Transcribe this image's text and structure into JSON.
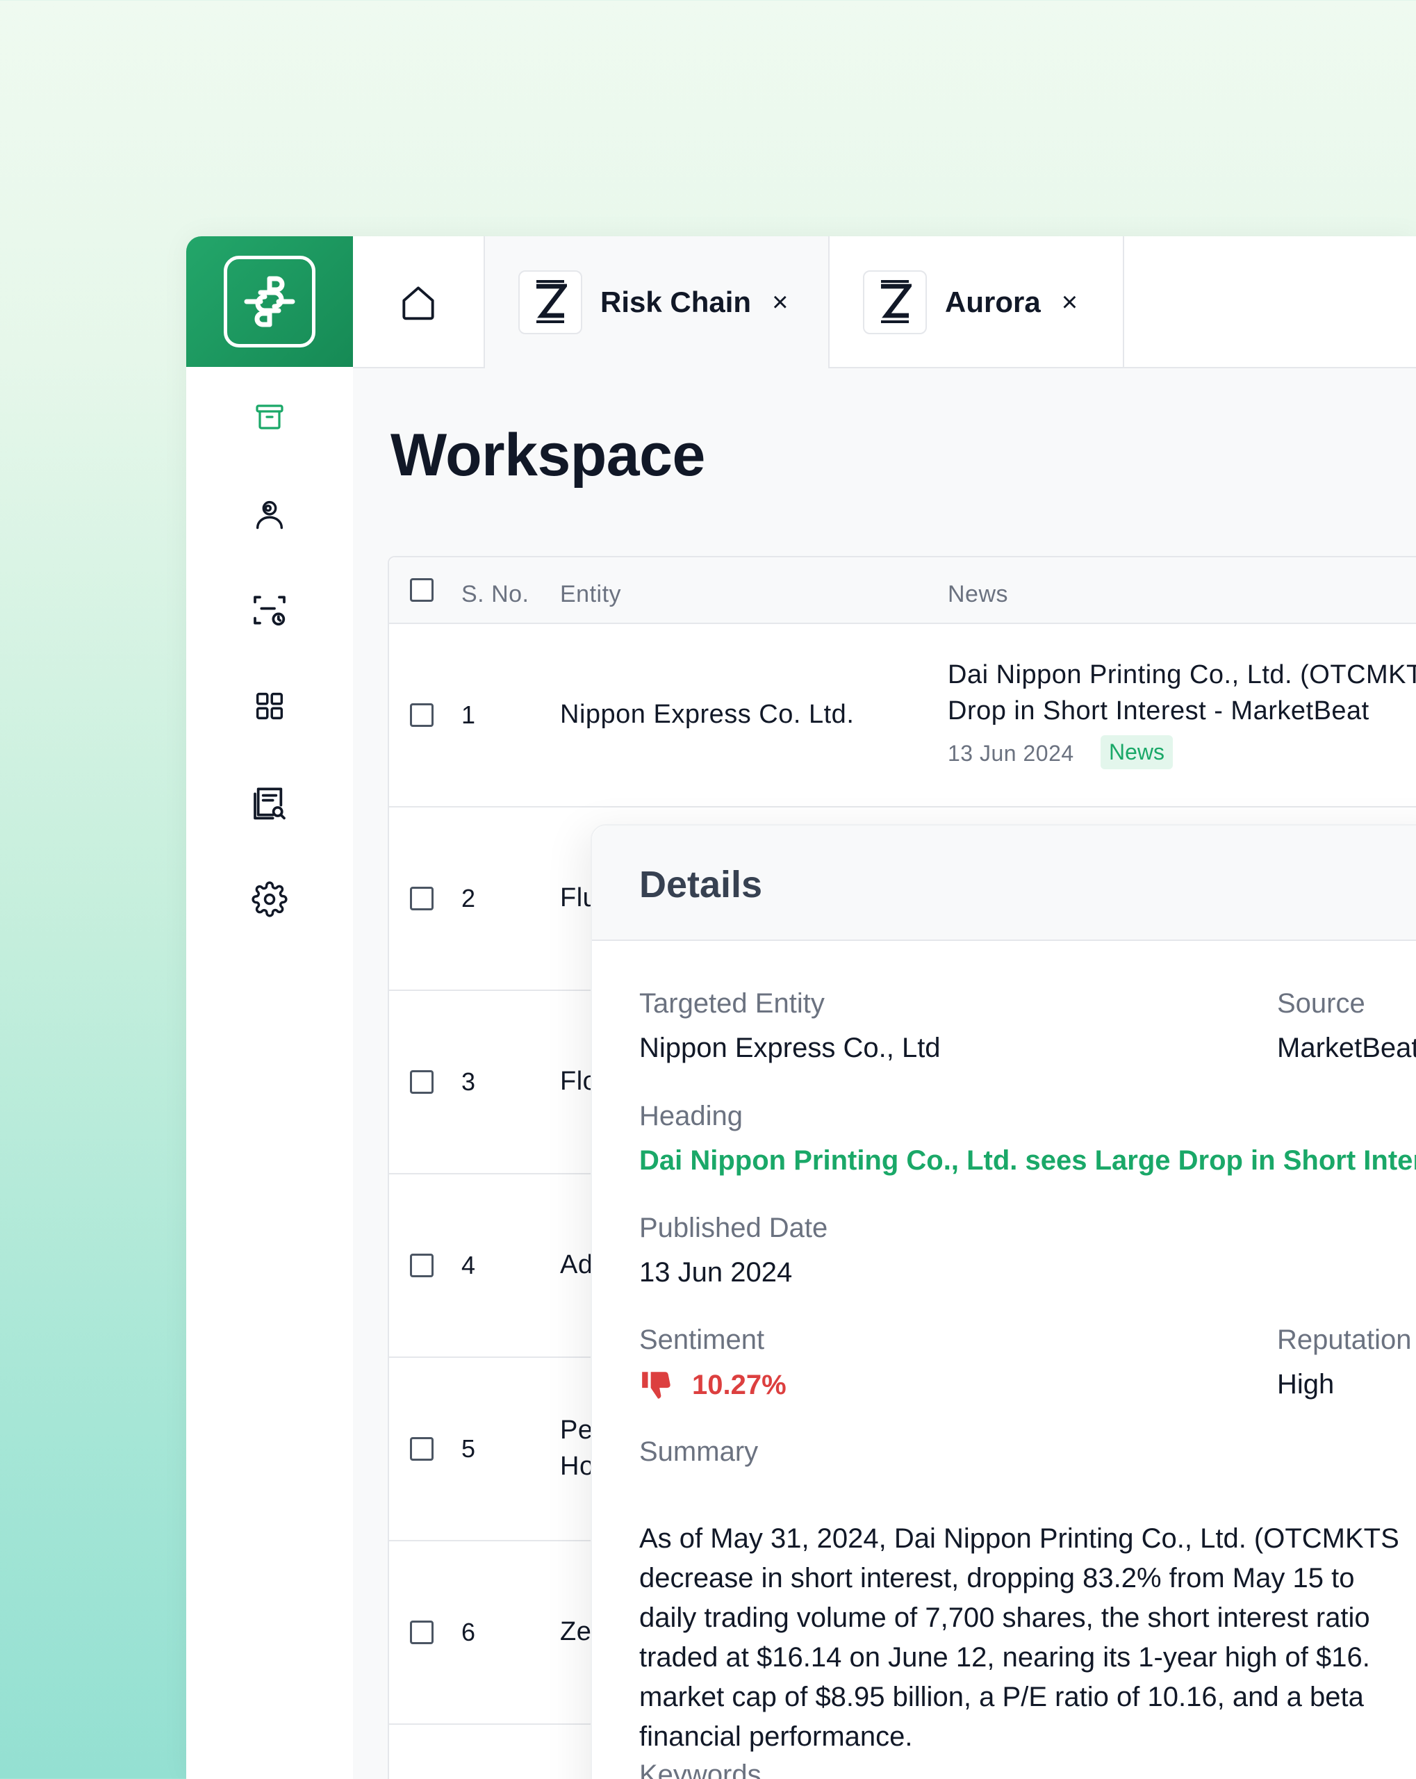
{
  "tabs": [
    {
      "label": "Risk Chain",
      "close": "×"
    },
    {
      "label": "Aurora",
      "close": "×"
    }
  ],
  "sidebar": {
    "items": [
      "archive-icon",
      "user-search-icon",
      "scan-clock-icon",
      "grid-icon",
      "document-search-icon",
      "gear-icon"
    ],
    "active_color": "#1aa868"
  },
  "page": {
    "title": "Workspace"
  },
  "table": {
    "headers": [
      "S. No.",
      "Entity",
      "News"
    ],
    "rows": [
      {
        "num": "1",
        "entity": "Nippon Express Co. Ltd.",
        "news_line1": "Dai Nippon Printing Co., Ltd. (OTCMKTS",
        "news_line2": "Drop in Short Interest - MarketBeat",
        "date": "13 Jun 2024",
        "badge": "News"
      },
      {
        "num": "2",
        "entity": "Flu"
      },
      {
        "num": "3",
        "entity": "Flo"
      },
      {
        "num": "4",
        "entity": "Ad"
      },
      {
        "num": "5",
        "entity": "Pe",
        "entity2": "Ho"
      },
      {
        "num": "6",
        "entity": "Ze"
      }
    ]
  },
  "details": {
    "title": "Details",
    "targeted_entity_label": "Targeted Entity",
    "targeted_entity": "Nippon Express Co., Ltd",
    "source_label": "Source",
    "source": "MarketBeat",
    "heading_label": "Heading",
    "heading": "Dai Nippon Printing Co., Ltd. sees Large Drop in Short Interest",
    "published_label": "Published Date",
    "published": "13 Jun 2024",
    "sentiment_label": "Sentiment",
    "sentiment": "10.27%",
    "reputation_label": "Reputation",
    "reputation": "High",
    "summary_label": "Summary",
    "summary": [
      "As of May 31, 2024, Dai Nippon Printing Co., Ltd. (OTCMKTS",
      "decrease in short interest, dropping 83.2% from May 15 to",
      "daily trading volume of 7,700 shares, the short interest ratio",
      "traded at $16.14 on June 12, nearing its 1-year high of $16.",
      "market cap of $8.95 billion, a P/E ratio of 10.16, and a beta",
      "financial performance."
    ],
    "keywords_label": "Keywords"
  },
  "colors": {
    "brand": "#1aa868",
    "negative": "#dc3f3f"
  }
}
